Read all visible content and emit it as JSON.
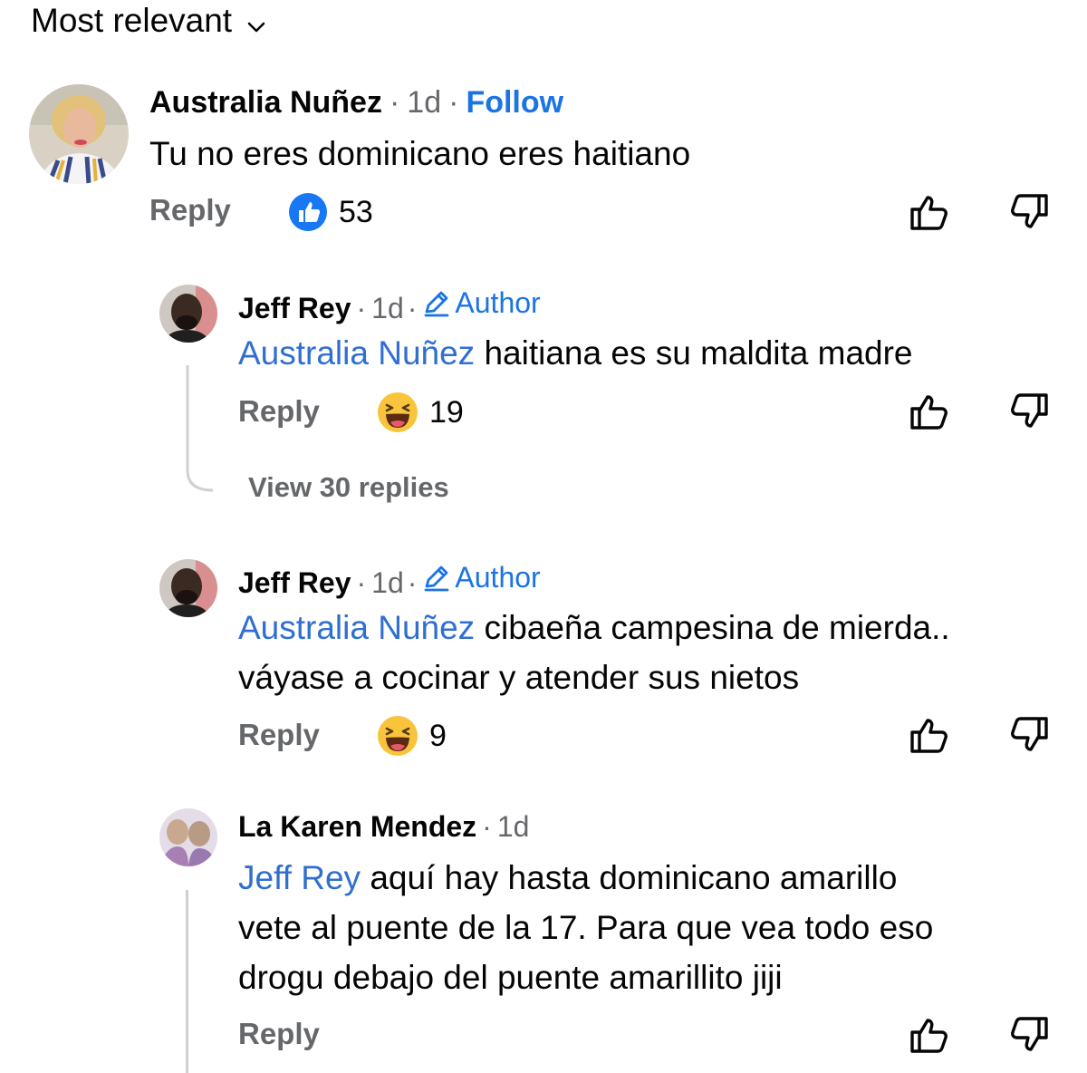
{
  "sort": {
    "label": "Most relevant"
  },
  "comments": [
    {
      "author": "Australia Nuñez",
      "time": "1d",
      "follow_label": "Follow",
      "text": "Tu no eres dominicano eres haitiano",
      "reply_label": "Reply",
      "reaction": {
        "type": "like",
        "count": "53"
      }
    },
    {
      "author": "Jeff Rey",
      "time": "1d",
      "badge_label": "Author",
      "mention": "Australia Nuñez",
      "text": " haitiana es su maldita madre",
      "reply_label": "Reply",
      "reaction": {
        "type": "haha",
        "count": "19"
      },
      "view_replies_label": "View 30 replies"
    },
    {
      "author": "Jeff Rey",
      "time": "1d",
      "badge_label": "Author",
      "mention": "Australia Nuñez",
      "text_line1": " cibaeña campesina de mierda..",
      "text_line2": "váyase a cocinar y atender sus nietos",
      "reply_label": "Reply",
      "reaction": {
        "type": "haha",
        "count": "9"
      }
    },
    {
      "author": "La Karen Mendez",
      "time": "1d",
      "mention": "Jeff Rey",
      "text_line1": " aquí hay hasta dominicano amarillo",
      "text_line2": "vete al puente de la 17. Para que vea todo eso",
      "text_line3": "drogu debajo del puente amarillito jiji",
      "reply_label": "Reply"
    }
  ],
  "colors": {
    "link_blue": "#1b74e4",
    "mention_blue": "#2f6fd1",
    "meta_gray": "#65676b",
    "like_blue": "#1877f2",
    "haha_yellow": "#f7c43c"
  },
  "icons": [
    "chevron-down-icon",
    "like-reaction-icon",
    "haha-reaction-icon",
    "thumbs-up-icon",
    "thumbs-down-icon",
    "pencil-icon"
  ]
}
